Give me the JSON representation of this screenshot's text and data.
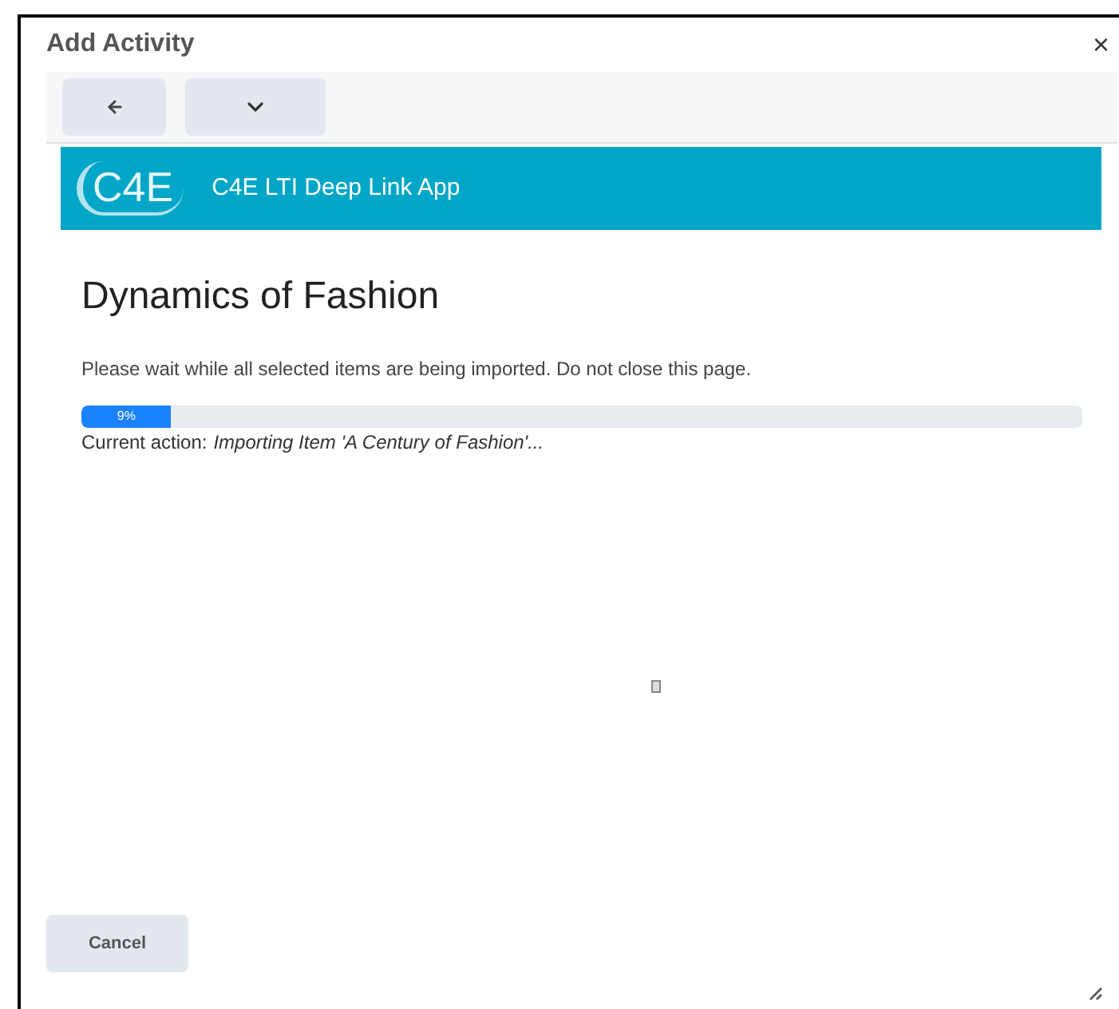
{
  "dialog": {
    "title": "Add Activity",
    "close": "×"
  },
  "banner": {
    "logo_text": "C4E",
    "title": "C4E LTI Deep Link App"
  },
  "heading": "Dynamics of Fashion",
  "message": "Please wait while all selected items are being imported. Do not close this page.",
  "progress": {
    "level": 0.09,
    "label": "9%"
  },
  "current_action": {
    "label": "Current action:",
    "value": "Importing Item 'A Century of Fashion'..."
  },
  "buttons": [
    "Cancel"
  ]
}
